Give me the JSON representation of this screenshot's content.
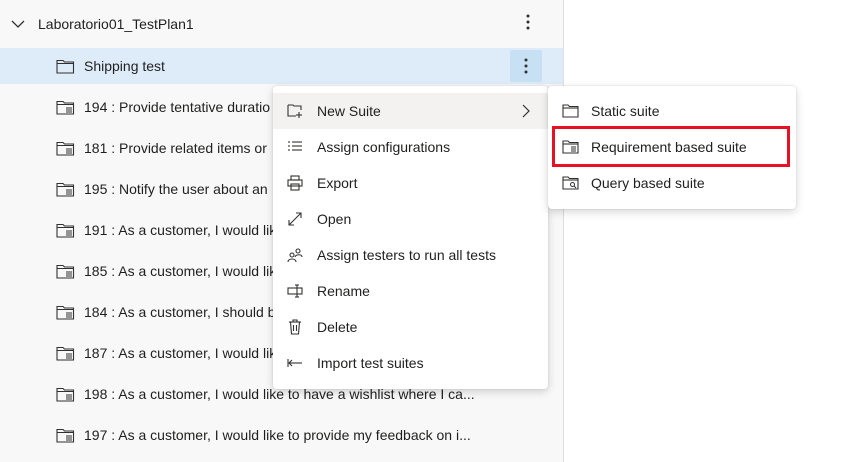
{
  "plan": {
    "title": "Laboratorio01_TestPlan1"
  },
  "suites": [
    {
      "label": "Shipping test",
      "icon": "folder-icon",
      "more": ""
    },
    {
      "label": "194 : Provide tentative duratio",
      "icon": "requirement-suite-icon",
      "more": ""
    },
    {
      "label": "181 : Provide related items or",
      "icon": "requirement-suite-icon",
      "more": ""
    },
    {
      "label": "195 : Notify the user about an",
      "icon": "requirement-suite-icon",
      "more": ""
    },
    {
      "label": "191 : As a customer, I would lik",
      "icon": "requirement-suite-icon",
      "more": ""
    },
    {
      "label": "185 : As a customer, I would lik",
      "icon": "requirement-suite-icon",
      "more": ""
    },
    {
      "label": "184 : As a customer, I should b",
      "icon": "requirement-suite-icon",
      "more": ""
    },
    {
      "label": "187 : As a customer, I would lik",
      "icon": "requirement-suite-icon",
      "more": ""
    },
    {
      "label": "198 : As a customer, I would like to have a wishlist where I ca...",
      "icon": "requirement-suite-icon",
      "more": "..."
    },
    {
      "label": "197 : As a customer, I would like to provide my feedback on i...",
      "icon": "requirement-suite-icon",
      "more": "..."
    }
  ],
  "context_menu": {
    "items": [
      {
        "label": "New Suite",
        "icon": "new-suite-icon"
      },
      {
        "label": "Assign configurations",
        "icon": "list-icon"
      },
      {
        "label": "Export",
        "icon": "print-icon"
      },
      {
        "label": "Open",
        "icon": "expand-icon"
      },
      {
        "label": "Assign testers to run all tests",
        "icon": "people-icon"
      },
      {
        "label": "Rename",
        "icon": "rename-icon"
      },
      {
        "label": "Delete",
        "icon": "delete-icon"
      },
      {
        "label": "Import test suites",
        "icon": "import-icon"
      }
    ]
  },
  "submenu": {
    "items": [
      {
        "label": "Static suite",
        "icon": "folder-icon"
      },
      {
        "label": "Requirement based suite",
        "icon": "requirement-suite-icon"
      },
      {
        "label": "Query based suite",
        "icon": "query-suite-icon"
      }
    ]
  },
  "colors": {
    "selected_row": "#deecf9",
    "highlight_box": "#e81123",
    "menu_hover": "#f3f2f1"
  }
}
